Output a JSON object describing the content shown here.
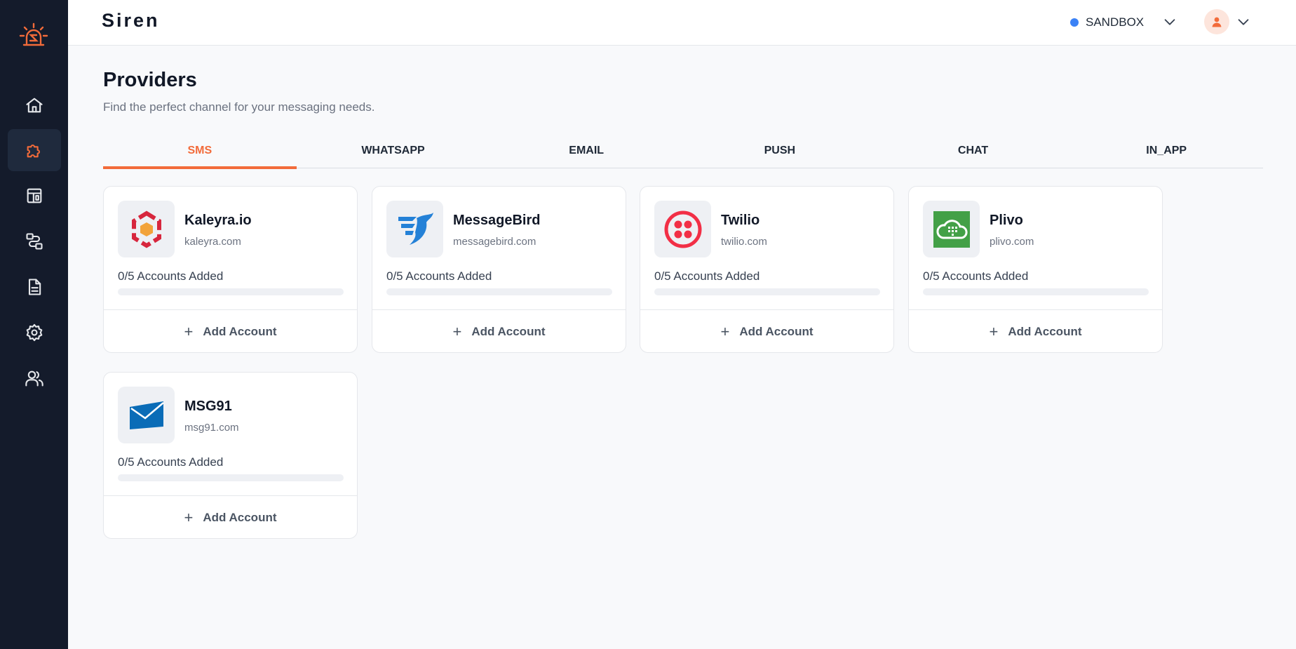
{
  "app": {
    "brand": "Siren"
  },
  "colors": {
    "accent": "#f26b3a",
    "sidebar": "#141b2b",
    "env_dot": "#3b82f6"
  },
  "header": {
    "environment": "SANDBOX"
  },
  "sidebar": {
    "items": [
      {
        "icon": "home-icon"
      },
      {
        "icon": "puzzle-icon",
        "active": true
      },
      {
        "icon": "layout-icon"
      },
      {
        "icon": "workflow-icon"
      },
      {
        "icon": "document-icon"
      },
      {
        "icon": "gear-icon"
      },
      {
        "icon": "users-icon"
      }
    ]
  },
  "page": {
    "title": "Providers",
    "subtitle": "Find the perfect channel for your messaging needs."
  },
  "tabs": [
    {
      "label": "SMS",
      "active": true
    },
    {
      "label": "WHATSAPP"
    },
    {
      "label": "EMAIL"
    },
    {
      "label": "PUSH"
    },
    {
      "label": "CHAT"
    },
    {
      "label": "IN_APP"
    }
  ],
  "providers": [
    {
      "name": "Kaleyra.io",
      "domain": "kaleyra.com",
      "accounts": "0/5 Accounts Added",
      "progress": 0,
      "add_label": "Add Account",
      "icon": "kaleyra-logo-icon"
    },
    {
      "name": "MessageBird",
      "domain": "messagebird.com",
      "accounts": "0/5 Accounts Added",
      "progress": 0,
      "add_label": "Add Account",
      "icon": "messagebird-logo-icon"
    },
    {
      "name": "Twilio",
      "domain": "twilio.com",
      "accounts": "0/5 Accounts Added",
      "progress": 0,
      "add_label": "Add Account",
      "icon": "twilio-logo-icon"
    },
    {
      "name": "Plivo",
      "domain": "plivo.com",
      "accounts": "0/5 Accounts Added",
      "progress": 0,
      "add_label": "Add Account",
      "icon": "plivo-logo-icon"
    },
    {
      "name": "MSG91",
      "domain": "msg91.com",
      "accounts": "0/5 Accounts Added",
      "progress": 0,
      "add_label": "Add Account",
      "icon": "msg91-logo-icon"
    }
  ]
}
